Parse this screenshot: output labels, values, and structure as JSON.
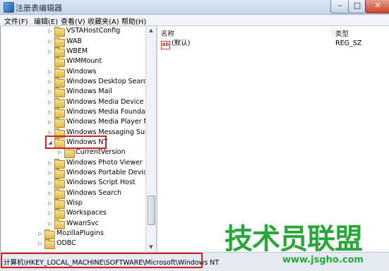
{
  "window": {
    "title": "注册表编辑器",
    "min_label": "–",
    "max_label": "□",
    "close_label": "✕"
  },
  "menu": [
    {
      "label": "文件(F)"
    },
    {
      "label": "编辑(E)"
    },
    {
      "label": "查看(V)"
    },
    {
      "label": "收藏夹(A)"
    },
    {
      "label": "帮助(H)"
    }
  ],
  "tree": [
    {
      "label": "VSTAHostConfig",
      "expander": "▷"
    },
    {
      "label": "WAB",
      "expander": "▷"
    },
    {
      "label": "WBEM",
      "expander": "▷"
    },
    {
      "label": "WIMMount",
      "expander": ""
    },
    {
      "label": "Windows",
      "expander": "▷"
    },
    {
      "label": "Windows Desktop Search",
      "expander": "▷"
    },
    {
      "label": "Windows Mail",
      "expander": "▷"
    },
    {
      "label": "Windows Media Device Ma",
      "expander": "▷"
    },
    {
      "label": "Windows Media Foundation",
      "expander": "▷"
    },
    {
      "label": "Windows Media Player NS",
      "expander": "▷"
    },
    {
      "label": "Windows Messaging Subsy",
      "expander": "▷"
    },
    {
      "label": "Windows NT",
      "expander": "◢"
    },
    {
      "label": "CurrentVersion",
      "expander": "▷"
    },
    {
      "label": "Windows Photo Viewer",
      "expander": "▷"
    },
    {
      "label": "Windows Portable Devices",
      "expander": "▷"
    },
    {
      "label": "Windows Script Host",
      "expander": "▷"
    },
    {
      "label": "Windows Search",
      "expander": "▷"
    },
    {
      "label": "Wisp",
      "expander": "▷"
    },
    {
      "label": "Workspaces",
      "expander": "▷"
    },
    {
      "label": "WwanSvc",
      "expander": "▷"
    },
    {
      "label": "MozillaPlugins",
      "expander": "▷"
    },
    {
      "label": "ODBC",
      "expander": "▷"
    }
  ],
  "values_pane": {
    "col_name": "名称",
    "col_type": "类型",
    "rows": [
      {
        "name": "(默认)",
        "type": "REG_SZ",
        "icon": "ab"
      }
    ]
  },
  "status": {
    "path": "计算机\\HKEY_LOCAL_MACHINE\\SOFTWARE\\Microsoft\\Windows NT"
  },
  "watermark": {
    "text": "技术员联盟",
    "url": "www.jsgho.com"
  },
  "colors": {
    "highlight": "#d0202a",
    "watermark": "#2aa63a"
  }
}
